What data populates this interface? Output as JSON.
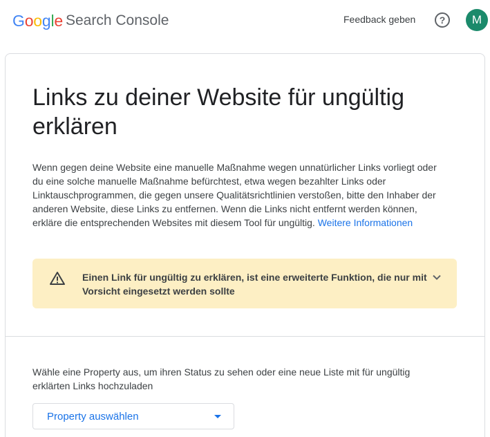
{
  "header": {
    "logo_google_letters": [
      {
        "char": "G",
        "color": "#4285F4"
      },
      {
        "char": "o",
        "color": "#EA4335"
      },
      {
        "char": "o",
        "color": "#FBBC05"
      },
      {
        "char": "g",
        "color": "#4285F4"
      },
      {
        "char": "l",
        "color": "#34A853"
      },
      {
        "char": "e",
        "color": "#EA4335"
      }
    ],
    "logo_product": "Search Console",
    "feedback_label": "Feedback geben",
    "help_icon": "help-circle-icon",
    "avatar_initial": "M",
    "avatar_color": "#1b8a6b"
  },
  "main": {
    "title": "Links zu deiner Website für ungültig erklären",
    "description": "Wenn gegen deine Website eine manuelle Maßnahme wegen unnatürlicher Links vorliegt oder du eine solche manuelle Maßnahme befürchtest, etwa wegen bezahlter Links oder Linktauschprogrammen, die gegen unsere Qualitätsrichtlinien verstoßen, bitte den Inhaber der anderen Website, diese Links zu entfernen. Wenn die Links nicht entfernt werden können, erkläre die entsprechenden Websites mit diesem Tool für ungültig.",
    "more_info_link": "Weitere Informationen",
    "warning": {
      "text": "Einen Link für ungültig zu erklären, ist eine erweiterte Funktion, die nur mit Vorsicht eingesetzt werden sollte",
      "icon": "warning-icon",
      "chevron_icon": "chevron-down-icon",
      "background": "#fdefc4"
    },
    "property_prompt": "Wähle eine Property aus, um ihren Status zu sehen oder eine neue Liste mit für ungültig erklärten Links hochzuladen",
    "property_select": {
      "label": "Property auswählen",
      "icon": "dropdown-arrow-icon"
    },
    "accent_color": "#1a73e8"
  }
}
